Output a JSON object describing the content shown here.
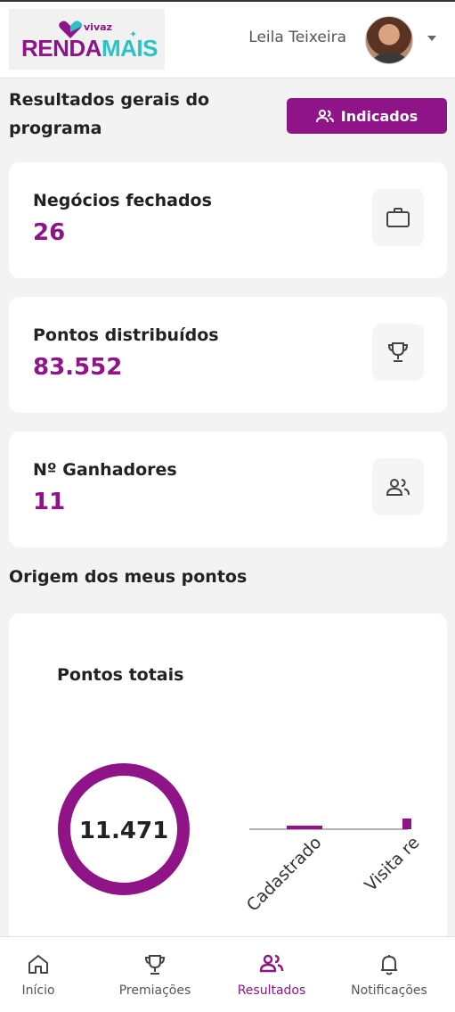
{
  "header": {
    "logo_top": "vivaz",
    "logo_part1": "RENDA",
    "logo_part2": "MAIS",
    "user_name": "Leila Teixeira"
  },
  "summary": {
    "title": "Resultados gerais do programa",
    "indicados_button": "Indicados"
  },
  "cards": [
    {
      "label": "Negócios fechados",
      "value": "26",
      "icon": "briefcase-icon"
    },
    {
      "label": "Pontos distribuídos",
      "value": "83.552",
      "icon": "trophy-icon"
    },
    {
      "label": "Nº Ganhadores",
      "value": "11",
      "icon": "users-icon"
    }
  ],
  "origem": {
    "title": "Origem dos meus pontos",
    "chart_title": "Pontos totais",
    "total": "11.471"
  },
  "chart_data": {
    "type": "bar",
    "title": "Pontos totais",
    "categories": [
      "Cadastrado",
      "Visita re"
    ],
    "values": [
      1,
      3
    ],
    "donut_total": "11.471",
    "colors": {
      "accent": "#8e1487"
    }
  },
  "nav": {
    "items": [
      {
        "label": "Início",
        "icon": "home-icon"
      },
      {
        "label": "Premiações",
        "icon": "trophy-icon"
      },
      {
        "label": "Resultados",
        "icon": "users-icon",
        "active": true
      },
      {
        "label": "Notificações",
        "icon": "bell-icon"
      }
    ]
  },
  "colors": {
    "primary": "#8e1487",
    "secondary": "#2cc3c8",
    "background": "#f3f3f3"
  }
}
